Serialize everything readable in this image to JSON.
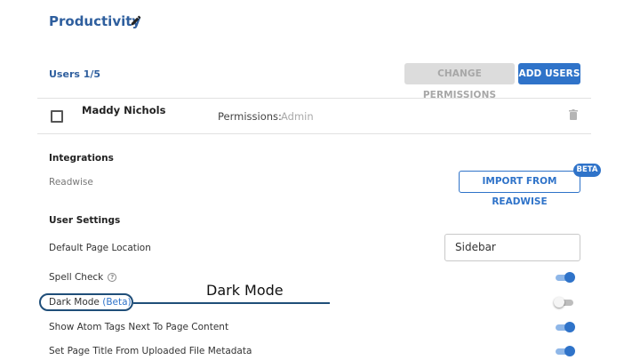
{
  "header": {
    "title": "Productivity"
  },
  "users": {
    "label": "Users",
    "count": "1/5",
    "change_permissions_label": "CHANGE PERMISSIONS",
    "add_users_label": "ADD USERS",
    "rows": [
      {
        "name": "Maddy Nichols",
        "permissions_label": "Permissions:",
        "permissions_value": "Admin"
      }
    ]
  },
  "integrations": {
    "title": "Integrations",
    "items": [
      {
        "name": "Readwise",
        "button_label": "IMPORT FROM READWISE",
        "badge": "BETA"
      }
    ]
  },
  "user_settings": {
    "title": "User Settings",
    "default_page_location": {
      "label": "Default Page Location",
      "value": "Sidebar"
    },
    "toggles": [
      {
        "label": "Spell Check",
        "on": true
      },
      {
        "label": "Dark Mode",
        "suffix": "(Beta)",
        "on": false
      },
      {
        "label": "Show Atom Tags Next To Page Content",
        "on": true
      },
      {
        "label": "Set Page Title From Uploaded File Metadata",
        "on": true
      }
    ]
  },
  "annotation": {
    "text": "Dark Mode",
    "color": "#1f4e79"
  },
  "colors": {
    "accent": "#2f73c9",
    "title": "#2f5f9e",
    "disabled_bg": "#dcdcdc"
  }
}
